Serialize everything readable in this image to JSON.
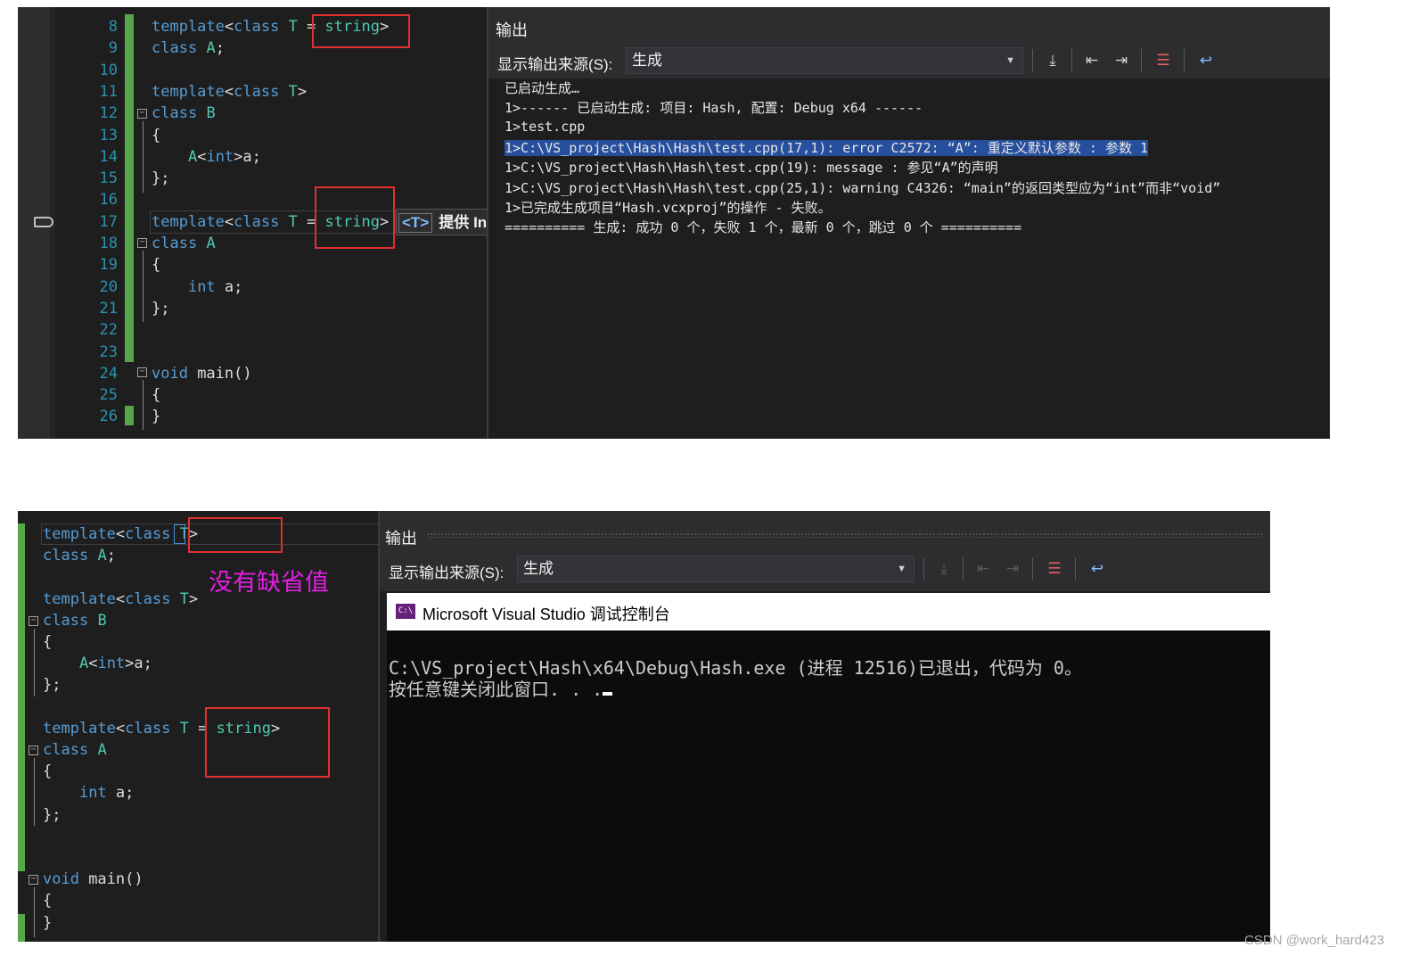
{
  "top": {
    "code_lines": [
      {
        "num": "8",
        "parts": [
          [
            "kw",
            "template"
          ],
          [
            "pl",
            "<"
          ],
          [
            "kw",
            "class"
          ],
          [
            "pl",
            " "
          ],
          [
            "ty",
            "T"
          ],
          [
            "pl",
            " = "
          ],
          [
            "ty",
            "string"
          ],
          [
            "pl",
            ">"
          ]
        ]
      },
      {
        "num": "9",
        "parts": [
          [
            "kw",
            "class"
          ],
          [
            "pl",
            " "
          ],
          [
            "ty",
            "A"
          ],
          [
            "pl",
            ";"
          ]
        ]
      },
      {
        "num": "10",
        "parts": []
      },
      {
        "num": "11",
        "parts": [
          [
            "kw",
            "template"
          ],
          [
            "pl",
            "<"
          ],
          [
            "kw",
            "class"
          ],
          [
            "pl",
            " "
          ],
          [
            "ty",
            "T"
          ],
          [
            "pl",
            ">"
          ]
        ]
      },
      {
        "num": "12",
        "parts": [
          [
            "kw",
            "class"
          ],
          [
            "pl",
            " "
          ],
          [
            "ty",
            "B"
          ]
        ]
      },
      {
        "num": "13",
        "parts": [
          [
            "pl",
            "{"
          ]
        ]
      },
      {
        "num": "14",
        "parts": [
          [
            "pl",
            "    "
          ],
          [
            "ty",
            "A"
          ],
          [
            "pl",
            "<"
          ],
          [
            "kw",
            "int"
          ],
          [
            "pl",
            ">a;"
          ]
        ]
      },
      {
        "num": "15",
        "parts": [
          [
            "pl",
            "};"
          ]
        ]
      },
      {
        "num": "16",
        "parts": []
      },
      {
        "num": "17",
        "parts": [
          [
            "kw",
            "template"
          ],
          [
            "pl",
            "<"
          ],
          [
            "kw",
            "class"
          ],
          [
            "pl",
            " "
          ],
          [
            "ty",
            "T"
          ],
          [
            "pl",
            " = "
          ],
          [
            "ty",
            "string"
          ],
          [
            "pl",
            ">"
          ]
        ]
      },
      {
        "num": "18",
        "parts": [
          [
            "kw",
            "class"
          ],
          [
            "pl",
            " "
          ],
          [
            "ty",
            "A"
          ]
        ]
      },
      {
        "num": "19",
        "parts": [
          [
            "pl",
            "{"
          ]
        ]
      },
      {
        "num": "20",
        "parts": [
          [
            "pl",
            "    "
          ],
          [
            "kw",
            "int"
          ],
          [
            "pl",
            " a;"
          ]
        ]
      },
      {
        "num": "21",
        "parts": [
          [
            "pl",
            "};"
          ]
        ]
      },
      {
        "num": "22",
        "parts": []
      },
      {
        "num": "23",
        "parts": []
      },
      {
        "num": "24",
        "parts": [
          [
            "kw",
            "void"
          ],
          [
            "pl",
            " main()"
          ]
        ]
      },
      {
        "num": "25",
        "parts": [
          [
            "pl",
            "{"
          ]
        ]
      },
      {
        "num": "26",
        "parts": [
          [
            "pl",
            "}"
          ]
        ]
      }
    ],
    "tooltip_tag": "<T>",
    "tooltip_text": "提供 In",
    "output": {
      "title": "输出",
      "source_label": "显示输出来源(S):",
      "source_value": "生成",
      "lines": [
        "已启动生成…",
        "1>------ 已启动生成: 项目: Hash, 配置: Debug x64 ------",
        "1>test.cpp",
        "1>C:\\VS_project\\Hash\\Hash\\test.cpp(17,1): error C2572: “A”: 重定义默认参数 : 参数 1",
        "1>C:\\VS_project\\Hash\\Hash\\test.cpp(19): message : 参见“A”的声明",
        "1>C:\\VS_project\\Hash\\Hash\\test.cpp(25,1): warning C4326: “main”的返回类型应为“int”而非“void”",
        "1>已完成生成项目“Hash.vcxproj”的操作 - 失败。",
        "========== 生成: 成功 0 个，失败 1 个，最新 0 个，跳过 0 个 =========="
      ],
      "highlighted_line_index": 3
    }
  },
  "bottom": {
    "code_lines": [
      {
        "parts": [
          [
            "kw",
            "template"
          ],
          [
            "pl",
            "<"
          ],
          [
            "kw",
            "class"
          ],
          [
            "pl",
            " "
          ],
          [
            "ty",
            "T"
          ],
          [
            "pl",
            ">"
          ]
        ]
      },
      {
        "parts": [
          [
            "kw",
            "class"
          ],
          [
            "pl",
            " "
          ],
          [
            "ty",
            "A"
          ],
          [
            "pl",
            ";"
          ]
        ]
      },
      {
        "parts": []
      },
      {
        "parts": [
          [
            "kw",
            "template"
          ],
          [
            "pl",
            "<"
          ],
          [
            "kw",
            "class"
          ],
          [
            "pl",
            " "
          ],
          [
            "ty",
            "T"
          ],
          [
            "pl",
            ">"
          ]
        ]
      },
      {
        "parts": [
          [
            "kw",
            "class"
          ],
          [
            "pl",
            " "
          ],
          [
            "ty",
            "B"
          ]
        ]
      },
      {
        "parts": [
          [
            "pl",
            "{"
          ]
        ]
      },
      {
        "parts": [
          [
            "pl",
            "    "
          ],
          [
            "ty",
            "A"
          ],
          [
            "pl",
            "<"
          ],
          [
            "kw",
            "int"
          ],
          [
            "pl",
            ">a;"
          ]
        ]
      },
      {
        "parts": [
          [
            "pl",
            "};"
          ]
        ]
      },
      {
        "parts": []
      },
      {
        "parts": [
          [
            "kw",
            "template"
          ],
          [
            "pl",
            "<"
          ],
          [
            "kw",
            "class"
          ],
          [
            "pl",
            " "
          ],
          [
            "ty",
            "T"
          ],
          [
            "pl",
            " = "
          ],
          [
            "ty",
            "string"
          ],
          [
            "pl",
            ">"
          ]
        ]
      },
      {
        "parts": [
          [
            "kw",
            "class"
          ],
          [
            "pl",
            " "
          ],
          [
            "ty",
            "A"
          ]
        ]
      },
      {
        "parts": [
          [
            "pl",
            "{"
          ]
        ]
      },
      {
        "parts": [
          [
            "pl",
            "    "
          ],
          [
            "kw",
            "int"
          ],
          [
            "pl",
            " a;"
          ]
        ]
      },
      {
        "parts": [
          [
            "pl",
            "};"
          ]
        ]
      },
      {
        "parts": []
      },
      {
        "parts": []
      },
      {
        "parts": [
          [
            "kw",
            "void"
          ],
          [
            "pl",
            " main()"
          ]
        ]
      },
      {
        "parts": [
          [
            "pl",
            "{"
          ]
        ]
      },
      {
        "parts": [
          [
            "pl",
            "}"
          ]
        ]
      }
    ],
    "annotation": "没有缺省值",
    "output": {
      "title": "输出",
      "source_label": "显示输出来源(S):",
      "source_value": "生成"
    },
    "console": {
      "title": "Microsoft Visual Studio 调试控制台",
      "icon_text": "C:\\",
      "lines": [
        "C:\\VS_project\\Hash\\x64\\Debug\\Hash.exe (进程 12516)已退出，代码为 0。",
        "按任意键关闭此窗口. . ."
      ]
    }
  },
  "watermark": "CSDN @work_hard423",
  "colors": {
    "keyword": "#569cd6",
    "type": "#4ec9b0",
    "text": "#dcdcdc",
    "line_number": "#2b91af",
    "change_bar": "#57a64a",
    "annotation_box": "#e03030",
    "annotation_text": "#e020e0",
    "selection": "#264f9d"
  }
}
